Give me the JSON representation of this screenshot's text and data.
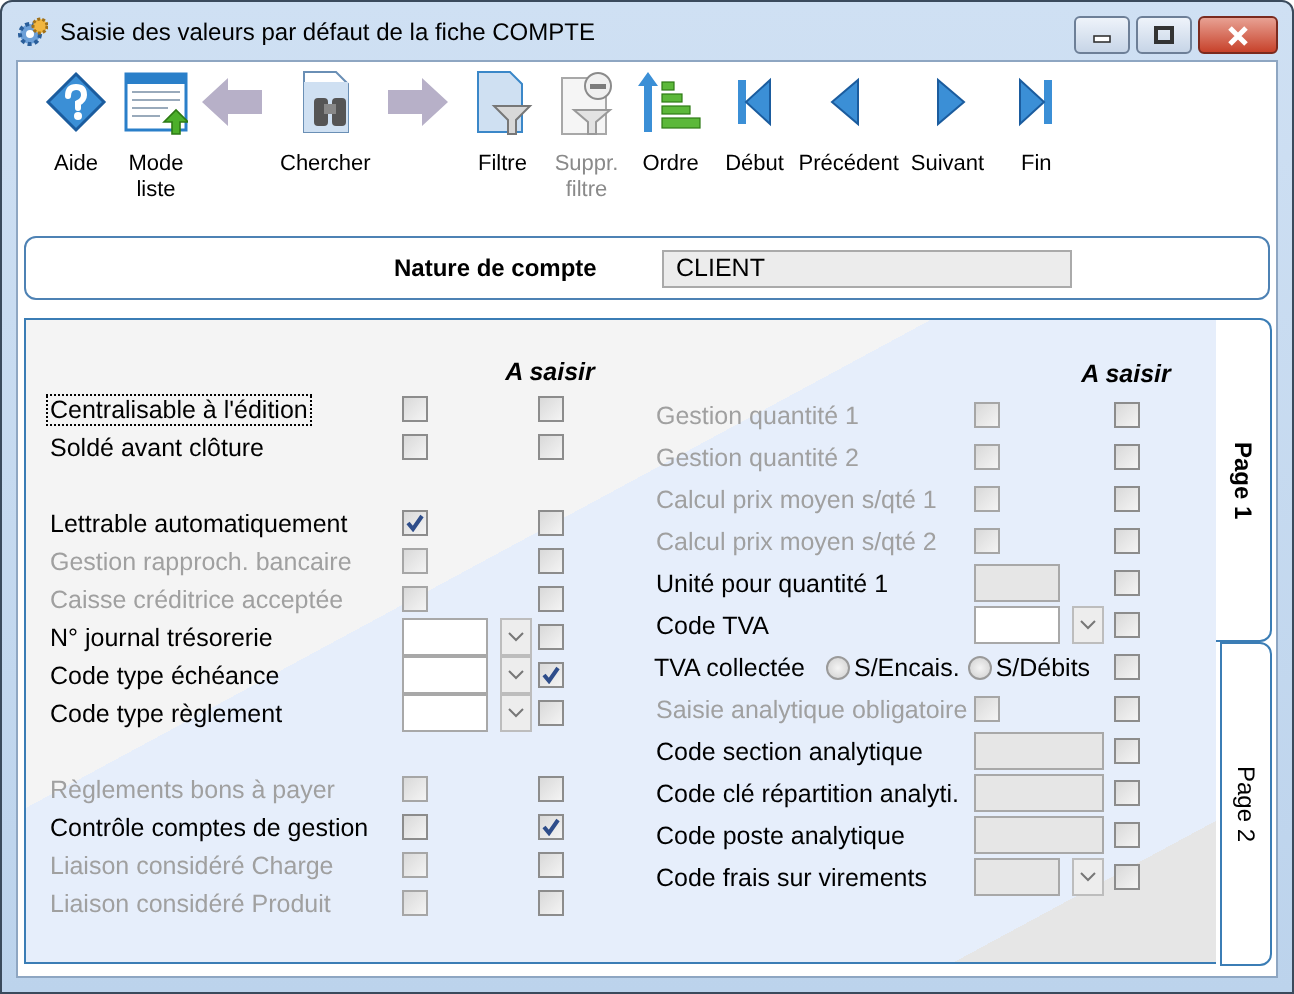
{
  "window": {
    "title": "Saisie des valeurs par défaut de la fiche COMPTE"
  },
  "toolbar": [
    {
      "kind": "help",
      "label": "Aide",
      "disabled": false
    },
    {
      "kind": "list",
      "label": "Mode\nliste",
      "disabled": false
    },
    {
      "kind": "back",
      "disabled": true
    },
    {
      "kind": "search",
      "label": "Chercher",
      "disabled": false
    },
    {
      "kind": "forward",
      "disabled": true
    },
    {
      "kind": "filter",
      "label": "Filtre",
      "disabled": false
    },
    {
      "kind": "unfilter",
      "label": "Suppr.\nfiltre",
      "disabled": true
    },
    {
      "kind": "sort",
      "label": "Ordre",
      "disabled": false
    },
    {
      "kind": "first",
      "label": "Début",
      "disabled": false
    },
    {
      "kind": "prev",
      "label": "Précédent",
      "disabled": false
    },
    {
      "kind": "next",
      "label": "Suivant",
      "disabled": false
    },
    {
      "kind": "last",
      "label": "Fin",
      "disabled": false
    }
  ],
  "header": {
    "label": "Nature de compte",
    "value": "CLIENT"
  },
  "form": {
    "columns": [
      {
        "required_header": "A saisir",
        "groups": [
          [
            {
              "kind": "check",
              "label": "Centralisable à l'édition",
              "disabled": false,
              "focused": true,
              "checked": false,
              "required": false
            },
            {
              "kind": "check",
              "label": "Soldé avant clôture",
              "disabled": false,
              "focused": false,
              "checked": false,
              "required": false
            }
          ],
          [
            {
              "kind": "check",
              "label": "Lettrable automatiquement",
              "disabled": false,
              "focused": false,
              "checked": true,
              "required": false
            },
            {
              "kind": "check",
              "label": "Gestion rapproch. bancaire",
              "disabled": true,
              "focused": false,
              "checked": false,
              "required": false
            },
            {
              "kind": "check",
              "label": "Caisse créditrice acceptée",
              "disabled": true,
              "focused": false,
              "checked": false,
              "required": false
            },
            {
              "kind": "combo",
              "label": "N° journal trésorerie",
              "disabled": false,
              "required": false
            },
            {
              "kind": "combo",
              "label": "Code type échéance",
              "disabled": false,
              "required": true
            },
            {
              "kind": "combo",
              "label": "Code type règlement",
              "disabled": false,
              "required": false
            }
          ],
          [
            {
              "kind": "check",
              "label": "Règlements bons à payer",
              "disabled": true,
              "focused": false,
              "checked": false,
              "required": false
            },
            {
              "kind": "check",
              "label": "Contrôle comptes de gestion",
              "disabled": false,
              "focused": false,
              "checked": false,
              "required": true
            },
            {
              "kind": "check",
              "label": "Liaison considéré Charge",
              "disabled": true,
              "focused": false,
              "checked": false,
              "required": false
            },
            {
              "kind": "check",
              "label": "Liaison considéré Produit",
              "disabled": true,
              "focused": false,
              "checked": false,
              "required": false
            }
          ]
        ]
      },
      {
        "required_header": "A saisir",
        "groups": [
          [
            {
              "kind": "check",
              "label": "Gestion quantité 1",
              "disabled": true,
              "focused": false,
              "checked": false,
              "required": false
            },
            {
              "kind": "check",
              "label": "Gestion quantité 2",
              "disabled": true,
              "focused": false,
              "checked": false,
              "required": false
            },
            {
              "kind": "check",
              "label": "Calcul prix moyen s/qté 1",
              "disabled": true,
              "focused": false,
              "checked": false,
              "required": false
            },
            {
              "kind": "check",
              "label": "Calcul prix moyen s/qté 2",
              "disabled": true,
              "focused": false,
              "checked": false,
              "required": false
            },
            {
              "kind": "short_field",
              "label": "Unité pour quantité 1",
              "disabled": true,
              "required": false
            },
            {
              "kind": "combo",
              "label": "Code TVA",
              "disabled": false,
              "required": false
            },
            {
              "kind": "radio",
              "label": "TVA collectée",
              "options": [
                {
                  "label": "S/Encais.",
                  "selected": false
                },
                {
                  "label": "S/Débits",
                  "selected": false
                }
              ],
              "required": false
            },
            {
              "kind": "check",
              "label": "Saisie analytique obligatoire",
              "disabled": true,
              "focused": false,
              "checked": false,
              "required": false
            },
            {
              "kind": "field",
              "label": "Code section analytique",
              "disabled": true,
              "required": false
            },
            {
              "kind": "field",
              "label": "Code clé répartition analyti.",
              "disabled": true,
              "required": false
            },
            {
              "kind": "field",
              "label": "Code poste analytique",
              "disabled": true,
              "required": false
            },
            {
              "kind": "combo",
              "label": "Code frais sur virements",
              "disabled": true,
              "required": false
            }
          ]
        ]
      }
    ]
  },
  "tabs": [
    {
      "label": "Page 1",
      "selected": true
    },
    {
      "label": "Page 2",
      "selected": false
    }
  ]
}
